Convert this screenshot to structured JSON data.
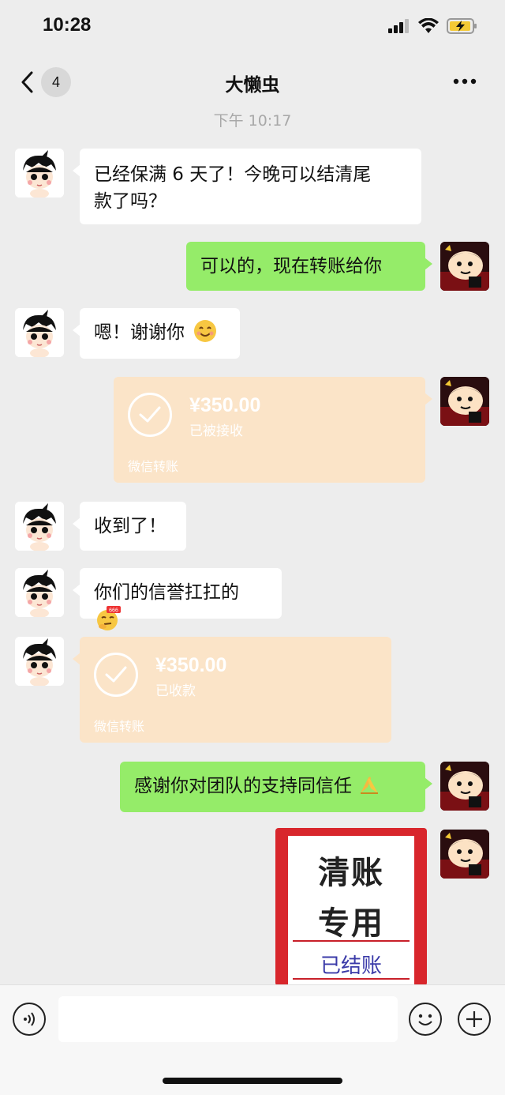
{
  "status": {
    "time": "10:28"
  },
  "nav": {
    "back_count": "4",
    "title": "大懒虫",
    "more_icon": "more-dots-icon"
  },
  "timestamp": "下午 10:17",
  "messages": [
    {
      "side": "left",
      "type": "text",
      "text_line1": "已经保满 6 天了！今晚可以结清尾",
      "text_line2": "款了吗？"
    },
    {
      "side": "right",
      "type": "text",
      "text": "可以的，现在转账给你"
    },
    {
      "side": "left",
      "type": "text",
      "text": "嗯！谢谢你",
      "emoji": "smile-emoji"
    },
    {
      "side": "right",
      "type": "transfer",
      "amount": "¥350.00",
      "status": "已被接收",
      "label": "微信转账"
    },
    {
      "side": "left",
      "type": "text",
      "text": "收到了！"
    },
    {
      "side": "left",
      "type": "text",
      "text": "你们的信誉扛扛的",
      "emoji": "666-thinking-emoji"
    },
    {
      "side": "left",
      "type": "transfer",
      "amount": "¥350.00",
      "status": "已收款",
      "label": "微信转账"
    },
    {
      "side": "right",
      "type": "text",
      "text": "感谢你对团队的支持同信任",
      "emoji": "pray-hands-emoji"
    },
    {
      "side": "right",
      "type": "sticker",
      "line1": "清账",
      "line2": "专用",
      "stamp": "已结账"
    }
  ],
  "colors": {
    "bg": "#ededed",
    "green_bubble": "#95ec69",
    "transfer": "#fbe4c8",
    "sticker_red": "#d8262c"
  }
}
